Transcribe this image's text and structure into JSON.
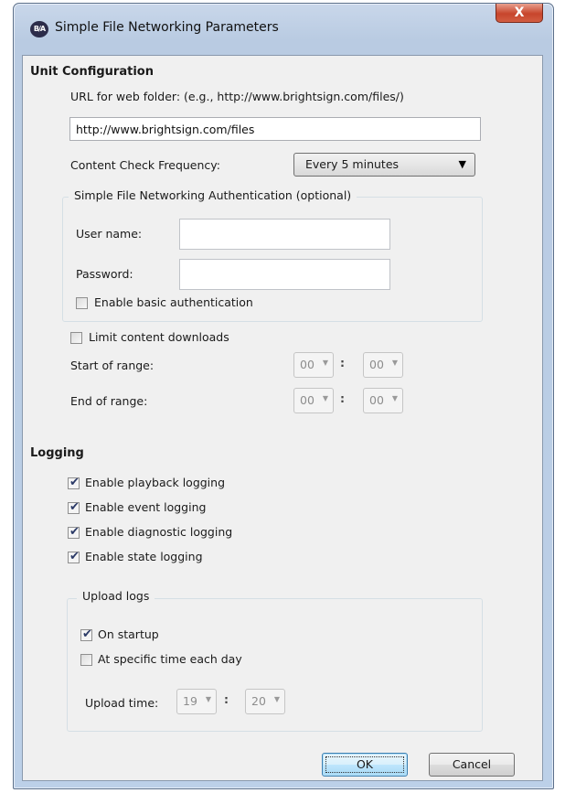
{
  "window": {
    "title": "Simple File Networking Parameters",
    "icon_text": "B/A",
    "close_symbol": "X"
  },
  "unit_config": {
    "heading": "Unit Configuration",
    "url_label": "URL for web folder: (e.g., http://www.brightsign.com/files/)",
    "url_value": "http://www.brightsign.com/files",
    "frequency_label": "Content Check Frequency:",
    "frequency_value": "Every 5 minutes",
    "frequency_arrow": "▼",
    "auth": {
      "legend": "Simple File Networking Authentication (optional)",
      "username_label": "User name:",
      "username_value": "",
      "password_label": "Password:",
      "password_value": "",
      "basic_auth_label": "Enable basic authentication",
      "basic_auth_checked": false
    },
    "limit_downloads_label": "Limit content downloads",
    "limit_downloads_checked": false,
    "start_label": "Start of range:",
    "start_hour": "00",
    "start_minute": "00",
    "end_label": "End of range:",
    "end_hour": "00",
    "end_minute": "00",
    "time_separator": ":"
  },
  "logging": {
    "heading": "Logging",
    "options": [
      {
        "label": "Enable playback logging",
        "checked": true
      },
      {
        "label": "Enable event logging",
        "checked": true
      },
      {
        "label": "Enable diagnostic logging",
        "checked": true
      },
      {
        "label": "Enable state logging",
        "checked": true
      }
    ],
    "upload": {
      "legend": "Upload logs",
      "on_startup_label": "On startup",
      "on_startup_checked": true,
      "specific_time_label": "At specific time each day",
      "specific_time_checked": false,
      "upload_time_label": "Upload time:",
      "upload_hour": "19",
      "upload_minute": "20"
    }
  },
  "buttons": {
    "ok_label": "OK",
    "cancel_label": "Cancel"
  },
  "glyphs": {
    "checkmark": "✔",
    "spin_arrow": "▼"
  },
  "colors": {
    "titlebar": "#bcd0e8",
    "client_bg": "#f0f0f0",
    "close_button": "#c7452c",
    "default_button": "#bee6fd"
  }
}
